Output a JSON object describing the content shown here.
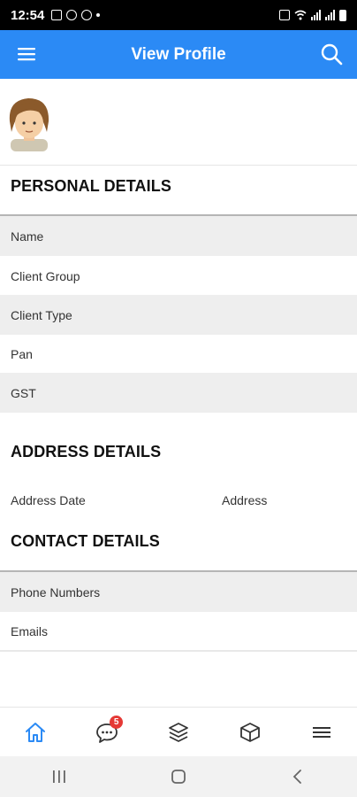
{
  "status_bar": {
    "time": "12:54"
  },
  "app_bar": {
    "title": "View Profile"
  },
  "personal": {
    "title": "PERSONAL DETAILS",
    "rows": [
      "Name",
      "Client Group",
      "Client Type",
      "Pan",
      "GST"
    ]
  },
  "address": {
    "title": "ADDRESS DETAILS",
    "date_label": "Address Date",
    "address_label": "Address"
  },
  "contact": {
    "title": "CONTACT DETAILS",
    "rows": [
      "Phone Numbers",
      "Emails"
    ]
  },
  "bottom_nav": {
    "active_color": "#2b8af5",
    "items": [
      "home-icon",
      "chat-icon",
      "layers-icon",
      "box-icon",
      "menu-icon"
    ],
    "chat_badge": "5"
  },
  "colors": {
    "accent": "#2b8af5",
    "badge": "#e53935"
  }
}
